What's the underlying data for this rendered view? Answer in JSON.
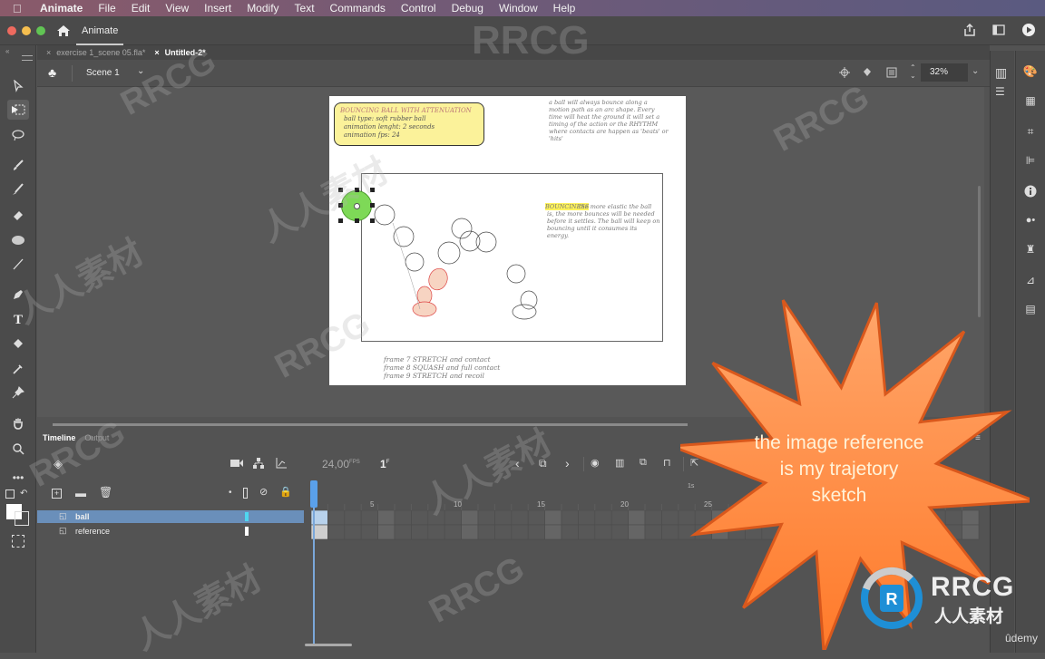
{
  "menubar": {
    "app": "Animate",
    "items": [
      "File",
      "Edit",
      "View",
      "Insert",
      "Modify",
      "Text",
      "Commands",
      "Control",
      "Debug",
      "Window",
      "Help"
    ]
  },
  "titlebar": {
    "workspace_tab": "Animate"
  },
  "document_tabs": [
    {
      "label": "exercise 1_scene 05.fla*",
      "active": false
    },
    {
      "label": "Untitled-2*",
      "active": true
    }
  ],
  "scene": {
    "name": "Scene 1",
    "zoom": "32%"
  },
  "stage": {
    "note_box": {
      "title": "BOUNCING BALL WITH ATTENUATION",
      "lines": [
        "ball type: soft rubber ball",
        "animation lenght: 2 seconds",
        "animation fps: 24"
      ]
    },
    "note_right": [
      "a ball will always bounce along a",
      "motion path as an arc shape. Every",
      "time will heat the ground it will set a",
      "timing of the action or the RHYTHM",
      "where contacts are happen as 'beats' or",
      "'hits'"
    ],
    "rhythm_word": "RHYTHM",
    "bounciness_label": "BOUNCINESS",
    "bounciness_text": [
      "the more elastic the ball",
      "is, the more bounces will be needed",
      "before it settles. The ball will keep on",
      "bouncing until it consumes its",
      "energy."
    ],
    "frame_notes": [
      "frame 7   STRETCH and contact",
      "frame 8   SQUASH and full contact",
      "frame 9   STRETCH and recoil"
    ],
    "selected_object_color": "#7ed957"
  },
  "timeline": {
    "tabs": [
      {
        "label": "Timeline",
        "active": true
      },
      {
        "label": "Output",
        "active": false
      }
    ],
    "fps": "24,00",
    "fps_unit": "FPS",
    "frame": "1",
    "frame_unit": "F",
    "ruler": [
      "5",
      "10",
      "15",
      "20",
      "25"
    ],
    "seconds_marker": "1s",
    "layers": [
      {
        "name": "ball",
        "selected": true,
        "color": "#4fd6f0"
      },
      {
        "name": "reference",
        "selected": false,
        "color": "#ffffff"
      }
    ]
  },
  "overlay": {
    "callout_text": [
      "the image reference",
      "is my trajetory",
      "sketch"
    ],
    "callout_color": "#ff8a3d"
  },
  "branding": {
    "logo_text": "RRCG",
    "logo_sub": "人人素材",
    "udemy": "ûdemy",
    "watermark": "RRCG",
    "watermark_cn": "人人素材"
  }
}
